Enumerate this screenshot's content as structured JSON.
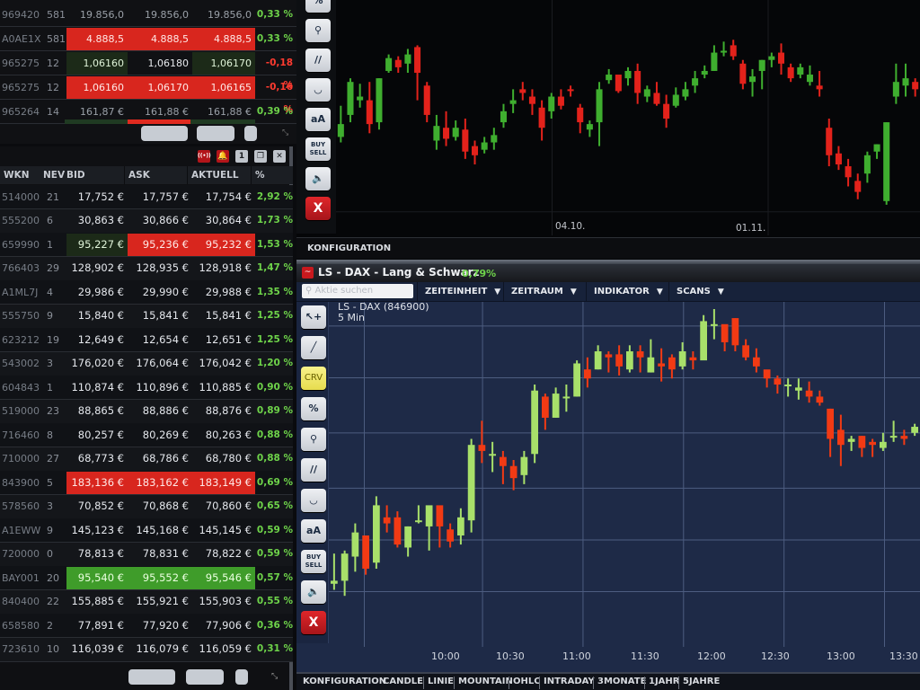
{
  "quote_top": {
    "rows": [
      {
        "wkn": "969420",
        "nev": "581",
        "bid": "19.856,0",
        "ask": "19.856,0",
        "aktuell": "19.856,0",
        "pct": "0,33 %",
        "style": "plain",
        "pct_dir": "up"
      },
      {
        "wkn": "A0AE1X",
        "nev": "581",
        "bid": "4.888,5",
        "ask": "4.888,5",
        "aktuell": "4.888,5",
        "pct": "0,33 %",
        "style": "red",
        "pct_dir": "up"
      },
      {
        "wkn": "965275",
        "nev": "12",
        "bid": "1,06160",
        "ask": "1,06180",
        "aktuell": "1,06170",
        "pct": "-0,18 %",
        "style": "dark",
        "pct_dir": "down"
      },
      {
        "wkn": "965275",
        "nev": "12",
        "bid": "1,06160",
        "ask": "1,06170",
        "aktuell": "1,06165",
        "pct": "-0,16 %",
        "style": "red",
        "pct_dir": "down"
      },
      {
        "wkn": "965264",
        "nev": "14",
        "bid": "161,87 €",
        "ask": "161,88 €",
        "aktuell": "161,88 €",
        "pct": "0,39 %",
        "style": "plain",
        "pct_dir": "up"
      }
    ]
  },
  "quote_main": {
    "panel_icons": [
      {
        "name": "live-signal-icon",
        "glyph": "((•))",
        "style": "red"
      },
      {
        "name": "alarm-bell-icon",
        "glyph": "🔔",
        "style": "red"
      },
      {
        "name": "panel-number-icon",
        "glyph": "1",
        "style": "grey"
      },
      {
        "name": "restore-window-icon",
        "glyph": "❐",
        "style": "grey"
      },
      {
        "name": "close-panel-icon",
        "glyph": "✕",
        "style": "grey"
      }
    ],
    "headers": {
      "wkn": "WKN",
      "nev": "NEV",
      "bid": "BID",
      "ask": "ASK",
      "aktuell": "AKTUELL",
      "pct": "%"
    },
    "rows": [
      {
        "wkn": "514000",
        "nev": "21",
        "bid": "17,752 €",
        "ask": "17,757 €",
        "aktuell": "17,754 €",
        "pct": "2,92 %",
        "hl": "none"
      },
      {
        "wkn": "555200",
        "nev": "6",
        "bid": "30,863 €",
        "ask": "30,866 €",
        "aktuell": "30,864 €",
        "pct": "1,73 %",
        "hl": "none"
      },
      {
        "wkn": "659990",
        "nev": "1",
        "bid": "95,227 €",
        "ask": "95,236 €",
        "aktuell": "95,232 €",
        "pct": "1,53 %",
        "hl": "mixed"
      },
      {
        "wkn": "766403",
        "nev": "29",
        "bid": "128,902 €",
        "ask": "128,935 €",
        "aktuell": "128,918 €",
        "pct": "1,47 %",
        "hl": "none"
      },
      {
        "wkn": "A1ML7J",
        "nev": "4",
        "bid": "29,986 €",
        "ask": "29,990 €",
        "aktuell": "29,988 €",
        "pct": "1,35 %",
        "hl": "none"
      },
      {
        "wkn": "555750",
        "nev": "9",
        "bid": "15,840 €",
        "ask": "15,841 €",
        "aktuell": "15,841 €",
        "pct": "1,25 %",
        "hl": "none"
      },
      {
        "wkn": "623212",
        "nev": "19",
        "bid": "12,649 €",
        "ask": "12,654 €",
        "aktuell": "12,651 €",
        "pct": "1,25 %",
        "hl": "none"
      },
      {
        "wkn": "543002",
        "nev": "3",
        "bid": "176,020 €",
        "ask": "176,064 €",
        "aktuell": "176,042 €",
        "pct": "1,20 %",
        "hl": "none"
      },
      {
        "wkn": "604843",
        "nev": "1",
        "bid": "110,874 €",
        "ask": "110,896 €",
        "aktuell": "110,885 €",
        "pct": "0,90 %",
        "hl": "none"
      },
      {
        "wkn": "519000",
        "nev": "23",
        "bid": "88,865 €",
        "ask": "88,886 €",
        "aktuell": "88,876 €",
        "pct": "0,89 %",
        "hl": "none"
      },
      {
        "wkn": "716460",
        "nev": "8",
        "bid": "80,257 €",
        "ask": "80,269 €",
        "aktuell": "80,263 €",
        "pct": "0,88 %",
        "hl": "none"
      },
      {
        "wkn": "710000",
        "nev": "27",
        "bid": "68,773 €",
        "ask": "68,786 €",
        "aktuell": "68,780 €",
        "pct": "0,88 %",
        "hl": "none"
      },
      {
        "wkn": "843900",
        "nev": "5",
        "bid": "183,136 €",
        "ask": "183,162 €",
        "aktuell": "183,149 €",
        "pct": "0,69 %",
        "hl": "red"
      },
      {
        "wkn": "578560",
        "nev": "3",
        "bid": "70,852 €",
        "ask": "70,868 €",
        "aktuell": "70,860 €",
        "pct": "0,65 %",
        "hl": "none"
      },
      {
        "wkn": "A1EWW",
        "nev": "9",
        "bid": "145,123 €",
        "ask": "145,168 €",
        "aktuell": "145,145 €",
        "pct": "0,59 %",
        "hl": "none"
      },
      {
        "wkn": "720000",
        "nev": "0",
        "bid": "78,813 €",
        "ask": "78,831 €",
        "aktuell": "78,822 €",
        "pct": "0,59 %",
        "hl": "none"
      },
      {
        "wkn": "BAY001",
        "nev": "20",
        "bid": "95,540 €",
        "ask": "95,552 €",
        "aktuell": "95,546 €",
        "pct": "0,57 %",
        "hl": "green"
      },
      {
        "wkn": "840400",
        "nev": "22",
        "bid": "155,885 €",
        "ask": "155,921 €",
        "aktuell": "155,903 €",
        "pct": "0,55 %",
        "hl": "none"
      },
      {
        "wkn": "658580",
        "nev": "2",
        "bid": "77,891 €",
        "ask": "77,920 €",
        "aktuell": "77,906 €",
        "pct": "0,36 %",
        "hl": "none"
      },
      {
        "wkn": "723610",
        "nev": "10",
        "bid": "116,039 €",
        "ask": "116,079 €",
        "aktuell": "116,059 €",
        "pct": "0,31 %",
        "hl": "none"
      }
    ]
  },
  "top_chart": {
    "tools": [
      {
        "name": "percent-tool-icon",
        "glyph": "%"
      },
      {
        "name": "zoom-tool-icon",
        "glyph": "⚲"
      },
      {
        "name": "parallel-lines-tool-icon",
        "glyph": "//"
      },
      {
        "name": "curve-tool-icon",
        "glyph": "◡"
      },
      {
        "name": "text-tool-icon",
        "glyph": "aA"
      },
      {
        "name": "buy-sell-icon",
        "glyph": "BUY SELL"
      },
      {
        "name": "sound-icon",
        "glyph": "🔈"
      },
      {
        "name": "close-chart-icon",
        "glyph": "X"
      }
    ],
    "date_labels": [
      "04.10.",
      "01.11."
    ],
    "konfiguration_label": "KONFIGURATION"
  },
  "bottom_chart": {
    "title": "LS - DAX - Lang & Schwarz",
    "change": "0,79%",
    "search_placeholder": "Aktie suchen",
    "menu": [
      "ZEITEINHEIT",
      "ZEITRAUM",
      "INDIKATOR",
      "SCANS"
    ],
    "instrument": "LS - DAX (846900)",
    "interval": "5 Min",
    "tools": [
      {
        "name": "cursor-add-icon",
        "glyph": "↖+"
      },
      {
        "name": "line-tool-icon",
        "glyph": "╱"
      },
      {
        "name": "crv-tool-icon",
        "glyph": "CRV"
      },
      {
        "name": "percent-tool-icon",
        "glyph": "%"
      },
      {
        "name": "zoom-tool-icon",
        "glyph": "⚲"
      },
      {
        "name": "parallel-lines-tool-icon",
        "glyph": "//"
      },
      {
        "name": "curve-tool-icon",
        "glyph": "◡"
      },
      {
        "name": "text-tool-icon",
        "glyph": "aA"
      },
      {
        "name": "buy-sell-icon",
        "glyph": "BUY SELL"
      },
      {
        "name": "sound-icon",
        "glyph": "🔈"
      },
      {
        "name": "close-chart-icon",
        "glyph": "X"
      }
    ],
    "bottom_tabs": [
      "KONFIGURATION",
      "CANDLE",
      "LINIE",
      "MOUNTAIN",
      "OHLC",
      "INTRADAY",
      "3MONATE",
      "1JAHR",
      "5JAHRE"
    ]
  },
  "chart_data": [
    {
      "type": "candlestick",
      "title": "",
      "xlabel": "",
      "ylabel": "",
      "x_tick_labels": [
        "04.10.",
        "01.11."
      ],
      "grid": true,
      "y_range": [
        0,
        100
      ],
      "up_color": "#3fae2f",
      "down_color": "#e3221b",
      "candles": [
        [
          40,
          47,
          57,
          37
        ],
        [
          52,
          70,
          72,
          48
        ],
        [
          60,
          62,
          69,
          56
        ],
        [
          60,
          47,
          70,
          42
        ],
        [
          48,
          72,
          72,
          44
        ],
        [
          76,
          83,
          85,
          75
        ],
        [
          82,
          78,
          84,
          75
        ],
        [
          80,
          85,
          88,
          75
        ],
        [
          89,
          75,
          90,
          60
        ],
        [
          68,
          52,
          70,
          48
        ],
        [
          38,
          46,
          52,
          33
        ],
        [
          45,
          39,
          54,
          35
        ],
        [
          40,
          45,
          49,
          38
        ],
        [
          44,
          32,
          50,
          28
        ],
        [
          35,
          30,
          38,
          25
        ],
        [
          33,
          37,
          40,
          31
        ],
        [
          37,
          41,
          45,
          33
        ],
        [
          48,
          54,
          58,
          45
        ],
        [
          58,
          60,
          66,
          53
        ],
        [
          66,
          64,
          70,
          60
        ],
        [
          62,
          58,
          66,
          52
        ],
        [
          56,
          45,
          60,
          38
        ],
        [
          54,
          62,
          64,
          50
        ],
        [
          62,
          57,
          66,
          55
        ],
        [
          66,
          65,
          68,
          62
        ],
        [
          56,
          48,
          58,
          42
        ],
        [
          44,
          47,
          49,
          40
        ],
        [
          48,
          66,
          70,
          35
        ],
        [
          71,
          74,
          77,
          69
        ],
        [
          74,
          65,
          73,
          64
        ],
        [
          72,
          76,
          78,
          68
        ],
        [
          76,
          64,
          80,
          58
        ],
        [
          62,
          66,
          68,
          59
        ],
        [
          64,
          58,
          70,
          57
        ],
        [
          58,
          50,
          63,
          45
        ],
        [
          57,
          63,
          67,
          56
        ],
        [
          62,
          66,
          70,
          60
        ],
        [
          68,
          72,
          76,
          64
        ],
        [
          74,
          76,
          79,
          72
        ],
        [
          76,
          86,
          90,
          76
        ],
        [
          86,
          87,
          92,
          84
        ],
        [
          90,
          84,
          93,
          82
        ],
        [
          80,
          69,
          82,
          66
        ],
        [
          70,
          73,
          77,
          62
        ],
        [
          76,
          82,
          82,
          66
        ],
        [
          82,
          84,
          86,
          78
        ],
        [
          86,
          80,
          91,
          74
        ],
        [
          78,
          72,
          80,
          70
        ],
        [
          74,
          78,
          80,
          72
        ],
        [
          70,
          74,
          79,
          68
        ],
        [
          68,
          66,
          76,
          62
        ],
        [
          45,
          30,
          50,
          24
        ],
        [
          31,
          25,
          35,
          22
        ],
        [
          24,
          18,
          28,
          13
        ],
        [
          16,
          10,
          20,
          6
        ],
        [
          20,
          30,
          32,
          15
        ],
        [
          32,
          36,
          36,
          28
        ],
        [
          5,
          48,
          48,
          3
        ],
        [
          62,
          70,
          80,
          58
        ],
        [
          68,
          72,
          80,
          62
        ],
        [
          70,
          66,
          72,
          62
        ]
      ]
    },
    {
      "type": "candlestick",
      "title": "LS - DAX (846900) 5 Min",
      "xlabel": "",
      "ylabel": "",
      "x_tick_labels": [
        "10:00",
        "10:30",
        "11:00",
        "11:30",
        "12:00",
        "12:30",
        "13:00",
        "13:30"
      ],
      "grid": true,
      "y_range": [
        0,
        100
      ],
      "up_color": "#a8e06a",
      "down_color": "#f23a14",
      "candles": [
        [
          9,
          10,
          19,
          7
        ],
        [
          10,
          19,
          20,
          5
        ],
        [
          18,
          26,
          29,
          13
        ],
        [
          25,
          14,
          25,
          12
        ],
        [
          16,
          35,
          38,
          14
        ],
        [
          31,
          29,
          35,
          26
        ],
        [
          31,
          22,
          33,
          21
        ],
        [
          21,
          28,
          28,
          18
        ],
        [
          30,
          30,
          35,
          29
        ],
        [
          28,
          35,
          33,
          20
        ],
        [
          35,
          28,
          33,
          21
        ],
        [
          27,
          23,
          29,
          21
        ],
        [
          25,
          31,
          34,
          22
        ],
        [
          30,
          55,
          57,
          26
        ],
        [
          55,
          53,
          63,
          49
        ],
        [
          52,
          52,
          56,
          46
        ],
        [
          51,
          48,
          53,
          42
        ],
        [
          48,
          44,
          50,
          40
        ],
        [
          45,
          51,
          53,
          42
        ],
        [
          52,
          73,
          75,
          49
        ],
        [
          71,
          64,
          72,
          60
        ],
        [
          64,
          72,
          74,
          64
        ],
        [
          71,
          71,
          75,
          66
        ],
        [
          71,
          82,
          83,
          71
        ],
        [
          80,
          77,
          84,
          74
        ],
        [
          80,
          86,
          88,
          80
        ],
        [
          85,
          84,
          86,
          79
        ],
        [
          85,
          81,
          88,
          78
        ],
        [
          80,
          86,
          88,
          79
        ],
        [
          86,
          84,
          88,
          79
        ],
        [
          79,
          84,
          90,
          79
        ],
        [
          82,
          81,
          87,
          76
        ],
        [
          84,
          80,
          85,
          77
        ],
        [
          81,
          86,
          89,
          80
        ],
        [
          84,
          83,
          86,
          80
        ],
        [
          83,
          96,
          98,
          84
        ],
        [
          95,
          95,
          100,
          90
        ],
        [
          95,
          89,
          94,
          86
        ],
        [
          97,
          88,
          97,
          86
        ],
        [
          88,
          84,
          90,
          83
        ],
        [
          84,
          81,
          87,
          79
        ],
        [
          80,
          77,
          79,
          74
        ],
        [
          77,
          75,
          78,
          72
        ],
        [
          75,
          75,
          77,
          71
        ],
        [
          73,
          74,
          77,
          70
        ],
        [
          73,
          71,
          76,
          69
        ],
        [
          71,
          69,
          73,
          68
        ],
        [
          67,
          57,
          67,
          51
        ],
        [
          60,
          55,
          65,
          48
        ],
        [
          56,
          57,
          58,
          53
        ],
        [
          58,
          54,
          58,
          51
        ],
        [
          56,
          55,
          57,
          51
        ],
        [
          54,
          56,
          59,
          53
        ],
        [
          58,
          58,
          63,
          56
        ],
        [
          58,
          57,
          60,
          55
        ],
        [
          59,
          61,
          62,
          58
        ]
      ]
    }
  ]
}
